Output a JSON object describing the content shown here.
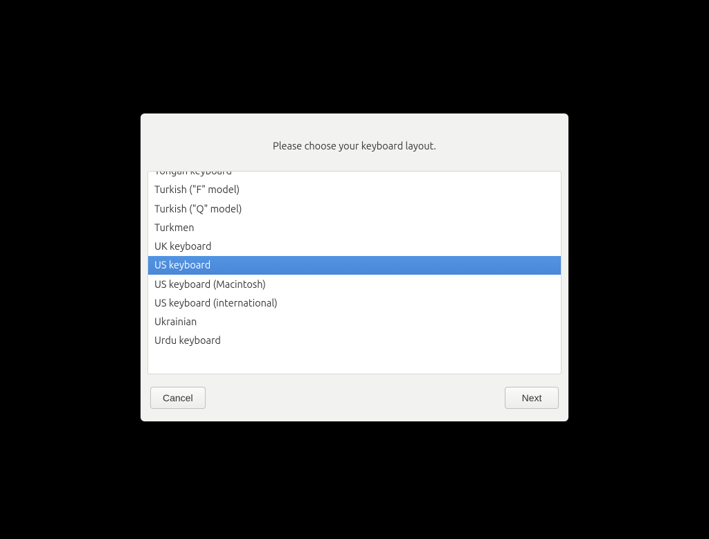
{
  "dialog": {
    "title": "Please choose your keyboard layout.",
    "items": [
      {
        "label": "Tongan keyboard",
        "selected": false
      },
      {
        "label": "Turkish (\"F\" model)",
        "selected": false
      },
      {
        "label": "Turkish (\"Q\" model)",
        "selected": false
      },
      {
        "label": "Turkmen",
        "selected": false
      },
      {
        "label": "UK keyboard",
        "selected": false
      },
      {
        "label": "US keyboard",
        "selected": true
      },
      {
        "label": "US keyboard (Macintosh)",
        "selected": false
      },
      {
        "label": "US keyboard (international)",
        "selected": false
      },
      {
        "label": "Ukrainian",
        "selected": false
      },
      {
        "label": "Urdu keyboard",
        "selected": false
      }
    ],
    "buttons": {
      "cancel": "Cancel",
      "next": "Next"
    }
  }
}
